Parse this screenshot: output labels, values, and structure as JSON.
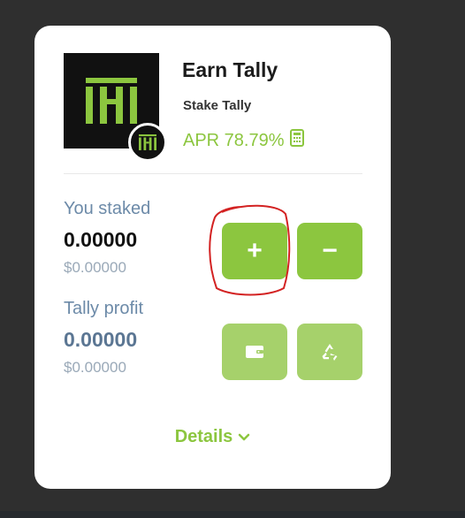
{
  "card": {
    "title": "Earn Tally",
    "subtitle": "Stake Tally",
    "apr": "APR 78.79%"
  },
  "staked": {
    "label": "You staked",
    "amount": "0.00000",
    "usd": "$0.00000"
  },
  "profit": {
    "label": "Tally profit",
    "amount": "0.00000",
    "usd": "$0.00000"
  },
  "buttons": {
    "add": "+",
    "remove": "−"
  },
  "details_label": "Details",
  "icons": [
    "tally-logo-icon",
    "tally-badge-icon",
    "calculator-icon",
    "wallet-icon",
    "recycle-icon",
    "chevron-down-icon"
  ],
  "colors": {
    "accent": "#8cc63f",
    "accent_soft": "#a6d16b",
    "label": "#6c8aa8",
    "muted": "#9aa9b8",
    "background": "#2f2f2f"
  }
}
